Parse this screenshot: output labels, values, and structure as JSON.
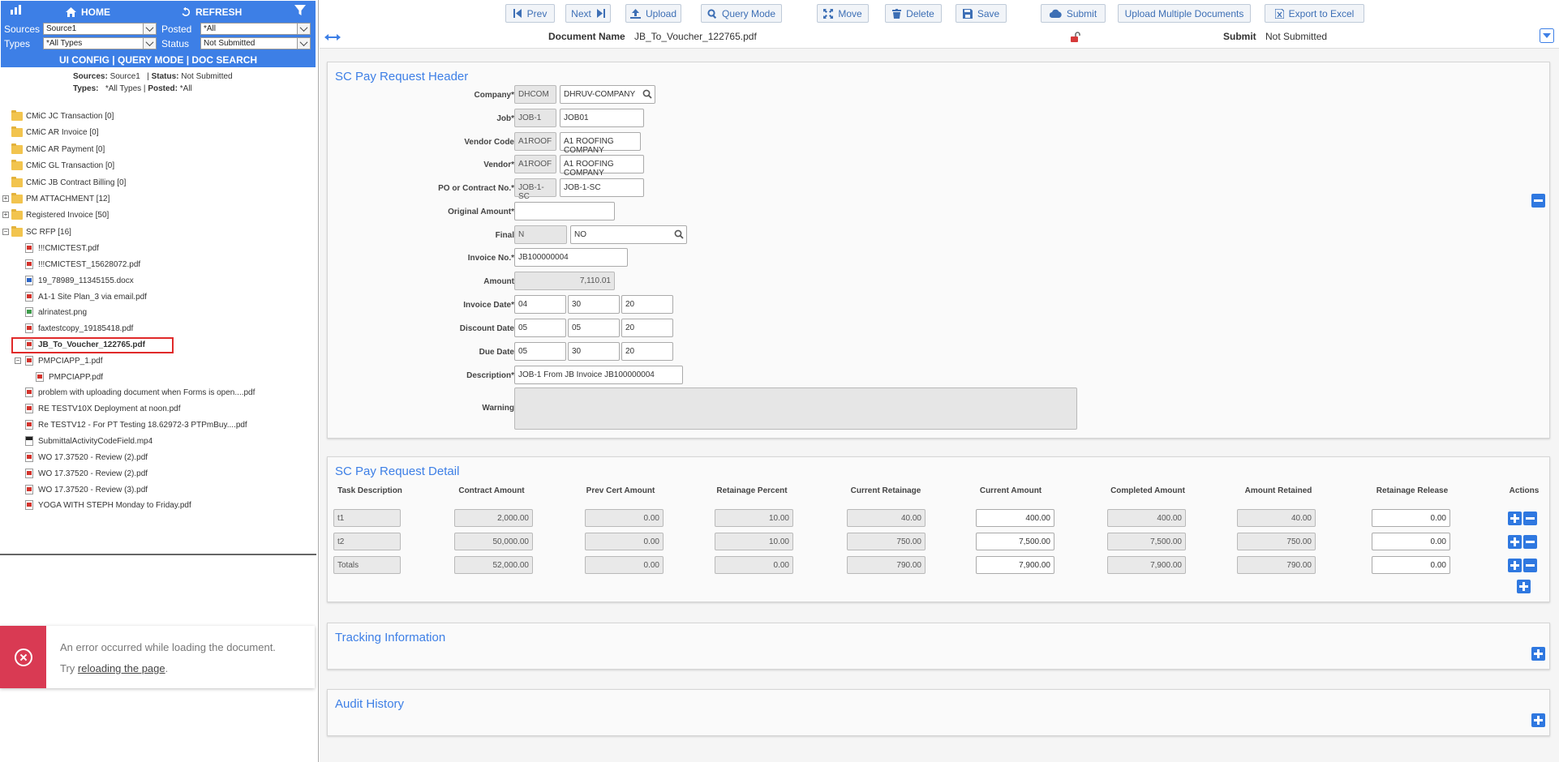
{
  "left": {
    "home_label": "HOME",
    "refresh_label": "REFRESH",
    "filters": {
      "sources_label": "Sources",
      "sources_value": "Source1",
      "posted_label": "Posted",
      "posted_value": "*All",
      "types_label": "Types",
      "types_value": "*All Types",
      "status_label": "Status",
      "status_value": "Not Submitted"
    },
    "links": [
      "UI CONFIG",
      "QUERY MODE",
      "DOC SEARCH"
    ],
    "link_sep": "|",
    "summary": {
      "sources_label": "Sources:",
      "sources_value": "Source1",
      "status_label": "Status:",
      "status_value": "Not Submitted",
      "types_label": "Types:",
      "types_value": "*All Types",
      "posted_label": "Posted:",
      "posted_value": "*All",
      "sep": "|"
    },
    "tree": {
      "folders": [
        "CMiC JC Transaction [0]",
        "CMiC AR Invoice [0]",
        "CMiC AR Payment [0]",
        "CMiC GL Transaction [0]",
        "CMiC JB Contract Billing [0]",
        "PM ATTACHMENT [12]",
        "Registered Invoice [50]",
        "SC RFP [16]"
      ],
      "files": [
        "!!!CMICTEST.pdf",
        "!!!CMICTEST_15628072.pdf",
        "19_78989_11345155.docx",
        "A1-1 Site Plan_3 via email.pdf",
        "alrinatest.png",
        "faxtestcopy_19185418.pdf",
        "JB_To_Voucher_122765.pdf",
        "PMPCIAPP_1.pdf",
        "PMPCIAPP.pdf",
        "problem with uploading document when Forms is open....pdf",
        "RE TESTV10X Deployment at noon.pdf",
        "Re TESTV12 - For PT Testing 18.62972-3 PTPmBuy....pdf",
        "SubmittalActivityCodeField.mp4",
        "WO 17.37520 - Review (2).pdf",
        "WO 17.37520 - Review (2).pdf",
        "WO 17.37520 - Review (3).pdf",
        "YOGA WITH STEPH Monday to Friday.pdf"
      ]
    },
    "error": {
      "message": "An error occurred while loading the document.",
      "try_prefix": "Try",
      "try_link": "reloading the page",
      "try_suffix": "."
    }
  },
  "toolbar": {
    "prev": "Prev",
    "next": "Next",
    "upload": "Upload",
    "query_mode": "Query Mode",
    "move": "Move",
    "delete": "Delete",
    "save": "Save",
    "submit": "Submit",
    "upload_multiple": "Upload Multiple Documents",
    "export": "Export to Excel"
  },
  "docbar": {
    "doc_name_label": "Document Name",
    "doc_name_value": "JB_To_Voucher_122765.pdf",
    "submit_label": "Submit",
    "submit_value": "Not Submitted"
  },
  "header": {
    "title": "SC Pay Request Header",
    "labels": {
      "company": "Company*",
      "job": "Job*",
      "vendor_code": "Vendor Code",
      "vendor": "Vendor*",
      "po": "PO or Contract No.*",
      "original_amount": "Original Amount*",
      "final": "Final",
      "invoice_no": "Invoice No.*",
      "amount": "Amount",
      "invoice_date": "Invoice Date*",
      "discount_date": "Discount Date",
      "due_date": "Due Date",
      "description": "Description*",
      "warning": "Warning"
    },
    "values": {
      "company_code": "DHCOM",
      "company_name": "DHRUV-COMPANY",
      "job_code": "JOB-1",
      "job_name": "JOB01",
      "vendor_code_code": "A1ROOF",
      "vendor_code_name": "A1 ROOFING COMPANY",
      "vendor_code2": "A1ROOF",
      "vendor_name": "A1 ROOFING COMPANY",
      "po_code": "JOB-1-SC",
      "po_name": "JOB-1-SC",
      "original_amount": "",
      "final_code": "N",
      "final_name": "NO",
      "invoice_no": "JB100000004",
      "amount": "7,110.01",
      "invoice_date": [
        "04",
        "30",
        "20"
      ],
      "discount_date": [
        "05",
        "05",
        "20"
      ],
      "due_date": [
        "05",
        "30",
        "20"
      ],
      "description": "JOB-1 From JB Invoice JB100000004",
      "warning": ""
    }
  },
  "detail": {
    "title": "SC Pay Request Detail",
    "columns": [
      "Task Description",
      "Contract Amount",
      "Prev Cert Amount",
      "Retainage Percent",
      "Current Retainage",
      "Current Amount",
      "Completed Amount",
      "Amount Retained",
      "Retainage Release",
      "Actions"
    ],
    "rows": [
      [
        "t1",
        "2,000.00",
        "0.00",
        "10.00",
        "40.00",
        "400.00",
        "400.00",
        "40.00",
        "0.00"
      ],
      [
        "t2",
        "50,000.00",
        "0.00",
        "10.00",
        "750.00",
        "7,500.00",
        "7,500.00",
        "750.00",
        "0.00"
      ],
      [
        "Totals",
        "52,000.00",
        "0.00",
        "0.00",
        "790.00",
        "7,900.00",
        "7,900.00",
        "790.00",
        "0.00"
      ]
    ]
  },
  "tracking": {
    "title": "Tracking Information"
  },
  "audit": {
    "title": "Audit History"
  }
}
